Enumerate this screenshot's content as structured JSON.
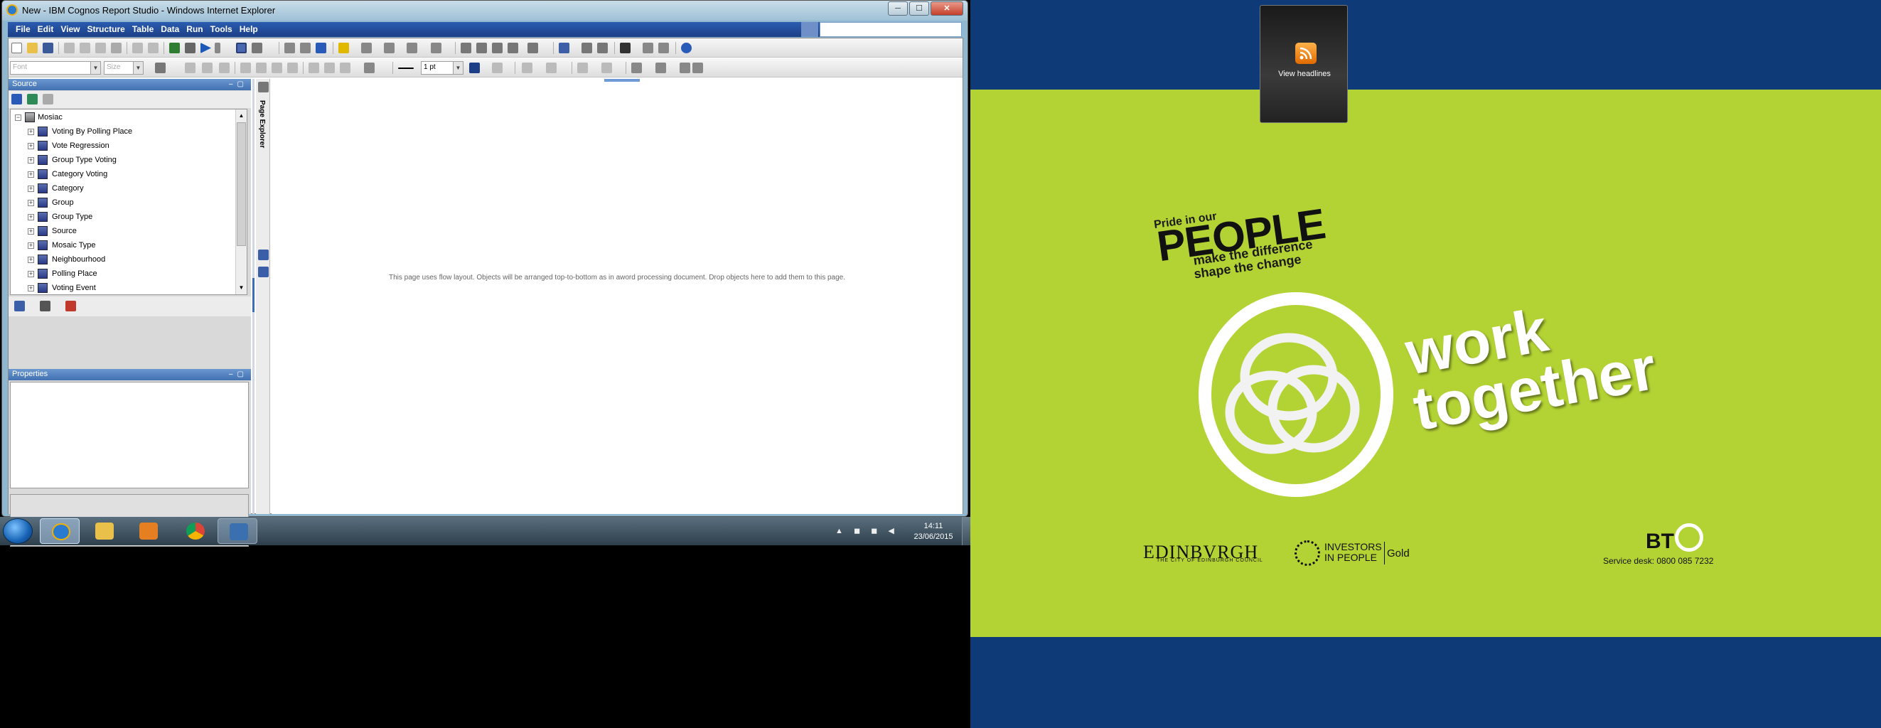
{
  "window": {
    "title": "New - IBM Cognos Report Studio - Windows Internet Explorer",
    "buttons": {
      "minimize": "─",
      "maximize": "☐",
      "close": "✕"
    }
  },
  "menu": [
    "File",
    "Edit",
    "View",
    "Structure",
    "Table",
    "Data",
    "Run",
    "Tools",
    "Help"
  ],
  "format_toolbar": {
    "font_placeholder": "Font",
    "size_placeholder": "Size",
    "border_width": "1 pt"
  },
  "source_pane": {
    "title": "Source",
    "tree": {
      "root": "Mosiac",
      "items": [
        "Voting By Polling Place",
        "Vote Regression",
        "Group Type Voting",
        "Category Voting",
        "Category",
        "Group",
        "Group Type",
        "Source",
        "Mosaic Type",
        "Neighbourhood",
        "Polling Place",
        "Voting Event"
      ]
    }
  },
  "properties_pane": {
    "title": "Properties"
  },
  "page_explorer": {
    "label": "Page Explorer"
  },
  "canvas": {
    "message": "This page uses flow layout. Objects will be arranged top-to-bottom as in aword processing document. Drop objects here to add them to this page."
  },
  "taskbar": {
    "clock_time": "14:11",
    "clock_date": "23/06/2015",
    "apps": [
      "internet-explorer",
      "file-explorer",
      "media-player",
      "chrome",
      "cognos"
    ]
  },
  "desktop": {
    "gadget_label": "View headlines",
    "wallpaper": {
      "pride": "Pride in our",
      "people": "PEOPLE",
      "tagline1": "make the difference",
      "tagline2": "shape the change",
      "work": "work",
      "together": "together",
      "edinburgh": "EDINBVRGH",
      "edinburgh_sub": "THE CITY OF EDINBURGH COUNCIL",
      "iip_line1": "INVESTORS",
      "iip_line2": "IN PEOPLE",
      "iip_level": "Gold",
      "bt": "BT",
      "service_desk": "Service desk: 0800 085 7232"
    },
    "colors": {
      "wallpaper_green": "#b3d334",
      "wallpaper_blue": "#0e3a78"
    }
  }
}
